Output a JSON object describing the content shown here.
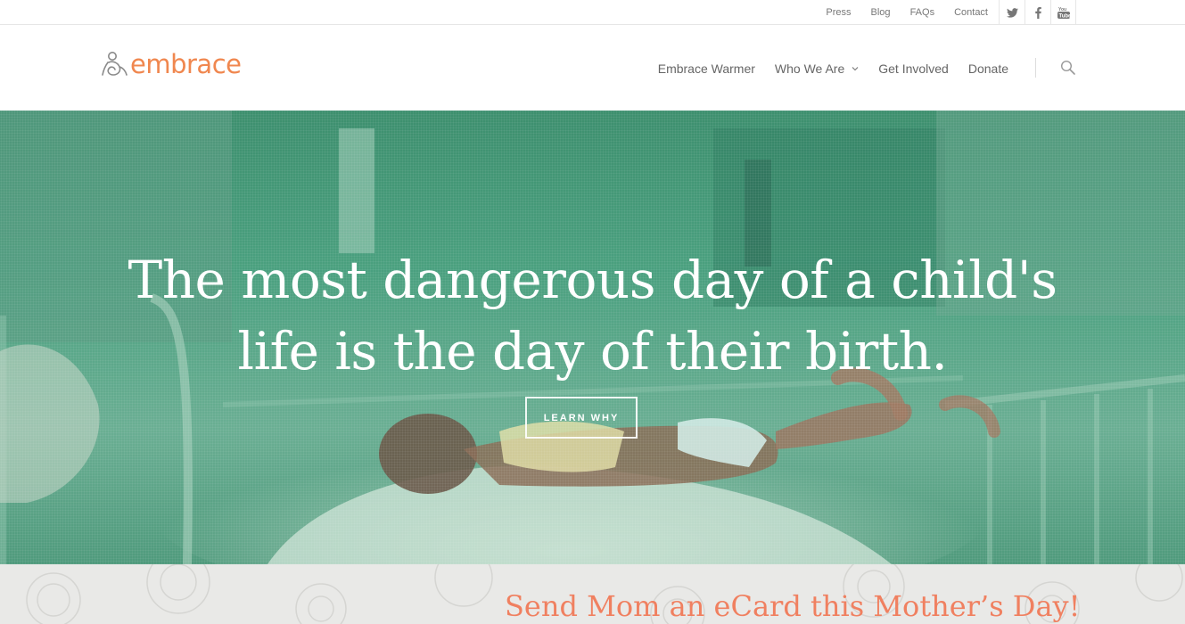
{
  "topbar": {
    "links": [
      "Press",
      "Blog",
      "FAQs",
      "Contact"
    ],
    "social_icons": [
      "twitter-icon",
      "facebook-icon",
      "youtube-icon"
    ]
  },
  "header": {
    "logo_text": "embrace",
    "nav": [
      {
        "label": "Embrace Warmer",
        "has_dropdown": false
      },
      {
        "label": "Who We Are",
        "has_dropdown": true
      },
      {
        "label": "Get Involved",
        "has_dropdown": false
      },
      {
        "label": "Donate",
        "has_dropdown": false
      }
    ],
    "search_icon": "search-icon"
  },
  "hero": {
    "headline_line1": "The most dangerous day of a child's",
    "headline_line2": "life is the day of their birth.",
    "cta_label": "LEARN WHY"
  },
  "promo": {
    "title": "Send Mom an eCard this Mother’s Day!"
  },
  "colors": {
    "brand_orange": "#f0874f",
    "hero_tint": "#3fa07e",
    "promo_title": "#f08060",
    "nav_text": "#666666"
  }
}
